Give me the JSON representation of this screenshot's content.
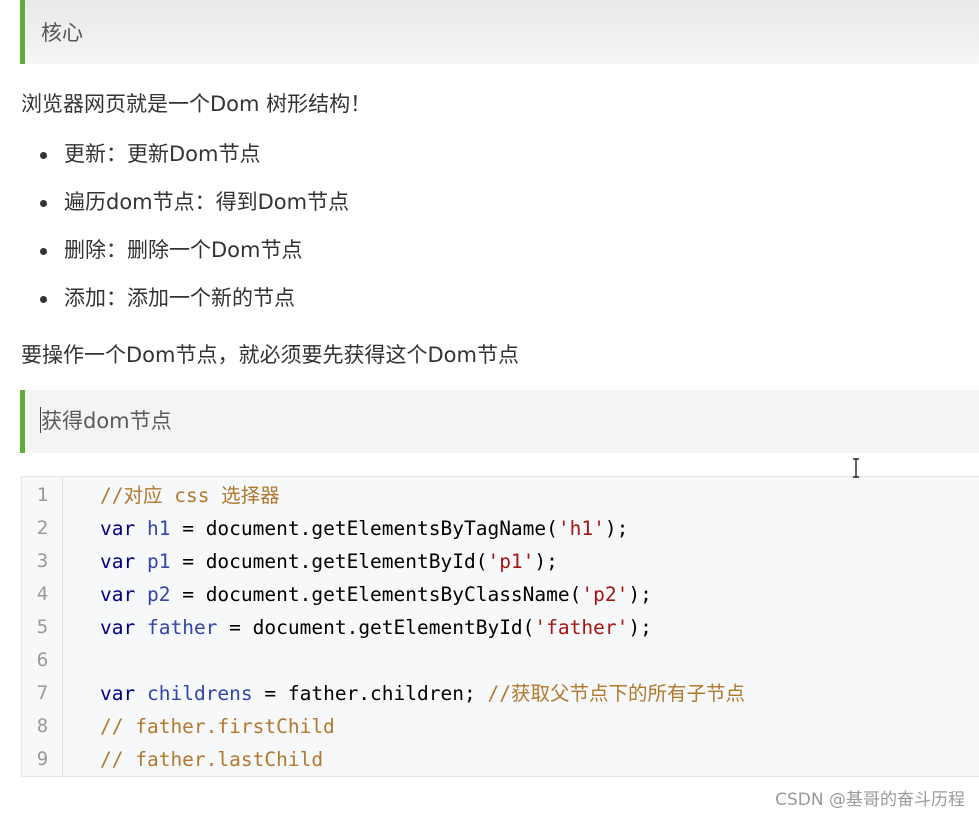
{
  "header_quote": {
    "text": "核心"
  },
  "intro": "浏览器网页就是一个Dom 树形结构！",
  "bullets": [
    "更新：更新Dom节点",
    "遍历dom节点：得到Dom节点",
    "删除：删除一个Dom节点",
    "添加：添加一个新的节点"
  ],
  "note": "要操作一个Dom节点，就必须要先获得这个Dom节点",
  "section_quote": {
    "text": "获得dom节点"
  },
  "code": {
    "line_numbers": [
      "1",
      "2",
      "3",
      "4",
      "5",
      "6",
      "7",
      "8",
      "9"
    ],
    "lines": [
      [
        {
          "t": "//对应 css 选择器",
          "c": "comment"
        }
      ],
      [
        {
          "t": "var",
          "c": "kw"
        },
        {
          "t": " ",
          "c": "plain"
        },
        {
          "t": "h1",
          "c": "var-name"
        },
        {
          "t": " = document.getElementsByTagName(",
          "c": "plain"
        },
        {
          "t": "'h1'",
          "c": "str"
        },
        {
          "t": ");",
          "c": "plain"
        }
      ],
      [
        {
          "t": "var",
          "c": "kw"
        },
        {
          "t": " ",
          "c": "plain"
        },
        {
          "t": "p1",
          "c": "var-name"
        },
        {
          "t": " = document.getElementById(",
          "c": "plain"
        },
        {
          "t": "'p1'",
          "c": "str"
        },
        {
          "t": ");",
          "c": "plain"
        }
      ],
      [
        {
          "t": "var",
          "c": "kw"
        },
        {
          "t": " ",
          "c": "plain"
        },
        {
          "t": "p2",
          "c": "var-name"
        },
        {
          "t": " = document.getElementsByClassName(",
          "c": "plain"
        },
        {
          "t": "'p2'",
          "c": "str"
        },
        {
          "t": ");",
          "c": "plain"
        }
      ],
      [
        {
          "t": "var",
          "c": "kw"
        },
        {
          "t": " ",
          "c": "plain"
        },
        {
          "t": "father",
          "c": "var-name"
        },
        {
          "t": " = document.getElementById(",
          "c": "plain"
        },
        {
          "t": "'father'",
          "c": "str"
        },
        {
          "t": ");",
          "c": "plain"
        }
      ],
      [],
      [
        {
          "t": "var",
          "c": "kw"
        },
        {
          "t": " ",
          "c": "plain"
        },
        {
          "t": "childrens",
          "c": "var-name"
        },
        {
          "t": " = father.children; ",
          "c": "plain"
        },
        {
          "t": "//获取父节点下的所有子节点",
          "c": "comment"
        }
      ],
      [
        {
          "t": "// father.firstChild",
          "c": "comment"
        }
      ],
      [
        {
          "t": "// father.lastChild",
          "c": "comment"
        }
      ]
    ]
  },
  "watermark": "CSDN @基哥的奋斗历程",
  "colors": {
    "quote_border": "#5fae37",
    "keyword": "#000080",
    "variable": "#3344aa",
    "comment": "#b1782e",
    "string": "#a31515"
  },
  "icons": {
    "mouse_cursor": "text-ibeam-cursor-icon"
  }
}
